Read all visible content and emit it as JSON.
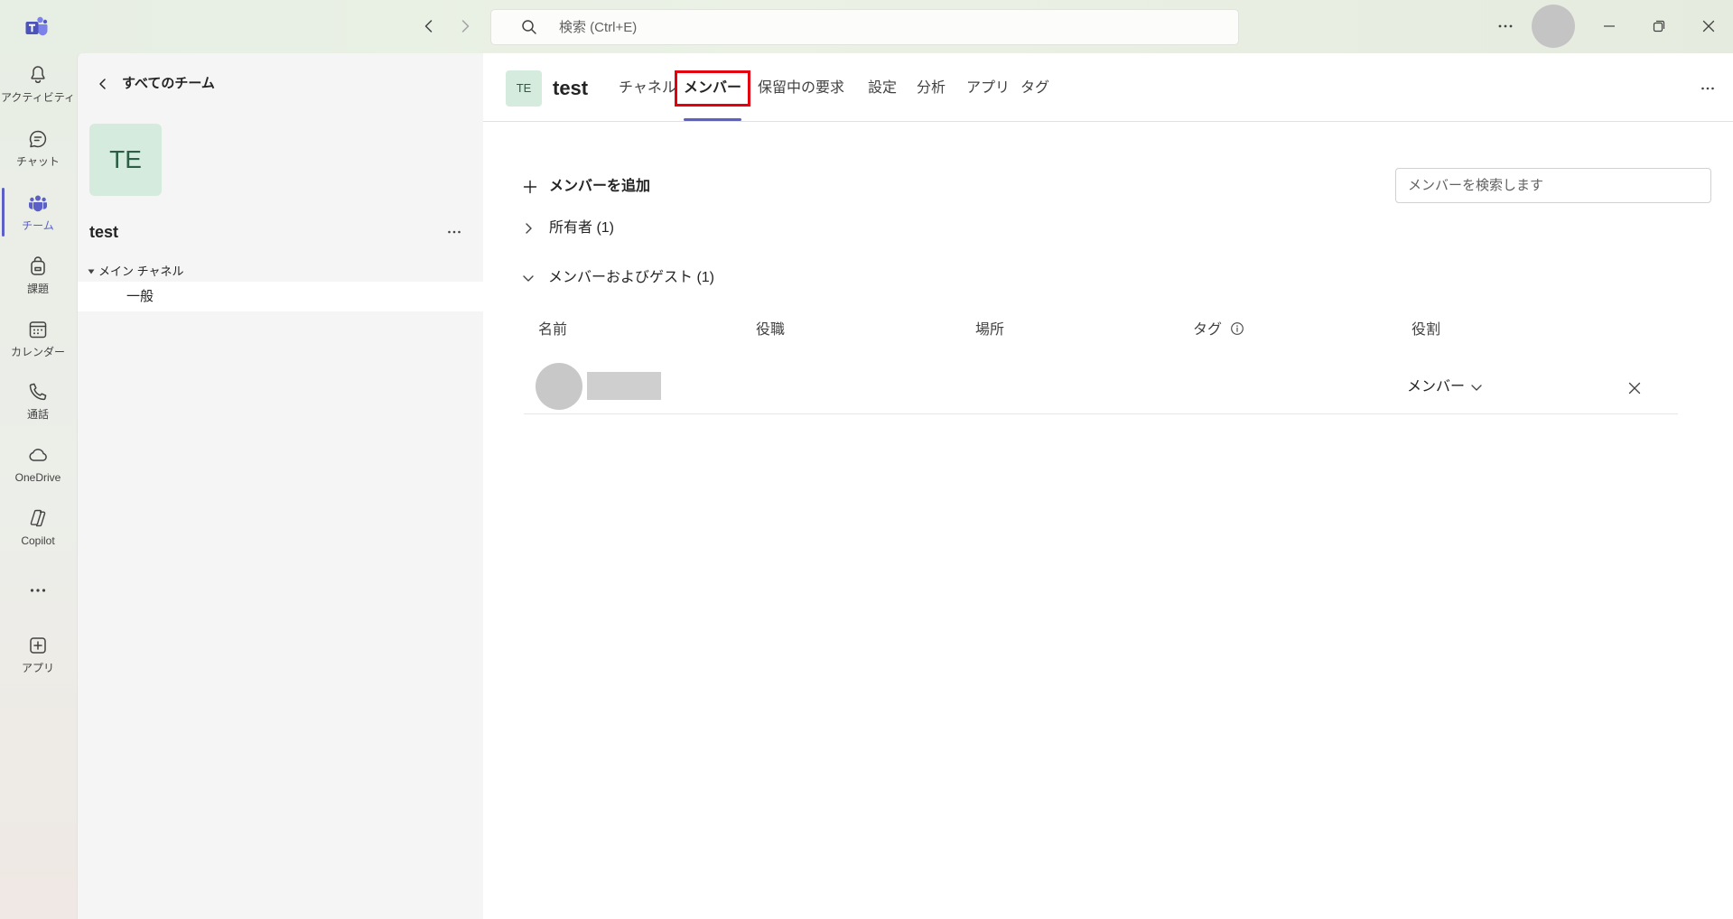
{
  "titlebar": {
    "search_placeholder": "検索 (Ctrl+E)",
    "icons": {
      "logo": "teams-logo-icon",
      "back": "chevron-left-icon",
      "forward": "chevron-right-icon",
      "search": "search-icon",
      "more": "more-horizontal-icon",
      "minimize": "minimize-icon",
      "restore": "restore-icon",
      "close": "close-icon"
    }
  },
  "rail": {
    "items": [
      {
        "label": "アクティビティ",
        "icon": "bell-icon"
      },
      {
        "label": "チャット",
        "icon": "chat-icon"
      },
      {
        "label": "チーム",
        "icon": "teams-icon",
        "active": true
      },
      {
        "label": "課題",
        "icon": "assignments-icon"
      },
      {
        "label": "カレンダー",
        "icon": "calendar-icon"
      },
      {
        "label": "通話",
        "icon": "phone-icon"
      },
      {
        "label": "OneDrive",
        "icon": "cloud-icon"
      },
      {
        "label": "Copilot",
        "icon": "copilot-icon"
      },
      {
        "label": "アプリ",
        "icon": "add-app-icon"
      }
    ],
    "more_icon": "more-horizontal-icon"
  },
  "team_panel": {
    "back_label": "すべてのチーム",
    "avatar_initials": "TE",
    "team_name": "test",
    "channel_group": "メイン チャネル",
    "channels": [
      {
        "name": "一般",
        "selected": true
      }
    ]
  },
  "header": {
    "avatar_initials": "TE",
    "team_name": "test",
    "tabs": [
      {
        "label": "チャネル"
      },
      {
        "label": "メンバー",
        "active": true
      },
      {
        "label": "保留中の要求"
      },
      {
        "label": "設定"
      },
      {
        "label": "分析"
      },
      {
        "label": "アプリ"
      },
      {
        "label": "タグ"
      }
    ]
  },
  "members": {
    "add_label": "メンバーを追加",
    "search_placeholder": "メンバーを検索します",
    "owners_section": "所有者 (1)",
    "owners_expanded": false,
    "members_section": "メンバーおよびゲスト (1)",
    "members_expanded": true,
    "columns": {
      "name": "名前",
      "title": "役職",
      "location": "場所",
      "tags": "タグ",
      "role": "役割"
    },
    "rows": [
      {
        "role": "メンバー"
      }
    ]
  },
  "colors": {
    "accent": "#5b5fc7",
    "highlight_box": "#e3000f",
    "team_avatar_bg": "#d4ebdd",
    "team_avatar_text": "#2b5e45"
  }
}
